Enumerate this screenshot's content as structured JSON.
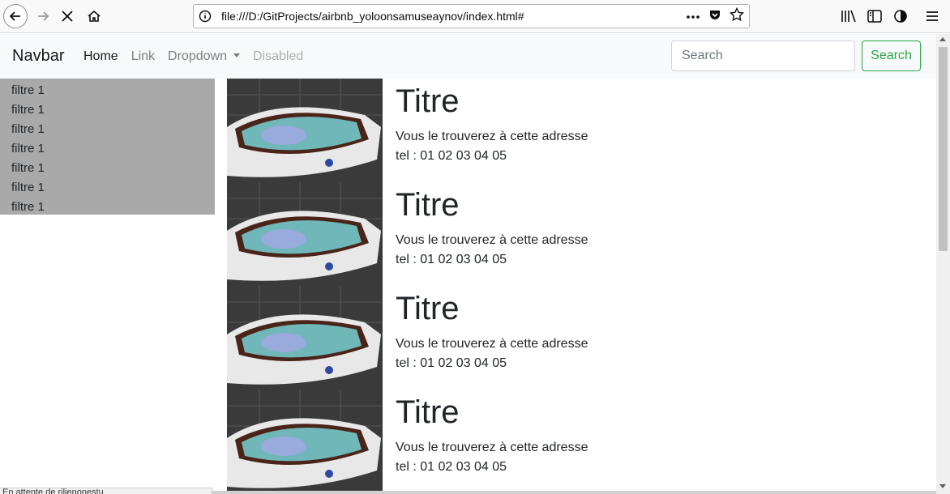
{
  "browser": {
    "url": "file:///D:/GitProjects/airbnb_yoloonsamuseaynov/index.html#",
    "status_text": "En attente de rilienonestu",
    "icons": [
      "back-icon",
      "forward-icon",
      "stop-icon",
      "home-icon",
      "info-icon",
      "more-icon",
      "pocket-icon",
      "star-icon",
      "library-icon",
      "sidebar-icon",
      "shield-icon",
      "menu-icon"
    ]
  },
  "navbar": {
    "brand": "Navbar",
    "links": [
      "Home",
      "Link",
      "Dropdown",
      "Disabled"
    ],
    "search_placeholder": "Search",
    "search_button": "Search"
  },
  "sidebar": {
    "filters": [
      "filtre 1",
      "filtre 1",
      "filtre 1",
      "filtre 1",
      "filtre 1",
      "filtre 1",
      "filtre 1"
    ]
  },
  "cards": [
    {
      "title": "Titre",
      "address": "Vous le trouverez à cette adresse",
      "tel": "tel : 01 02 03 04 05"
    },
    {
      "title": "Titre",
      "address": "Vous le trouverez à cette adresse",
      "tel": "tel : 01 02 03 04 05"
    },
    {
      "title": "Titre",
      "address": "Vous le trouverez à cette adresse",
      "tel": "tel : 01 02 03 04 05"
    },
    {
      "title": "Titre",
      "address": "Vous le trouverez à cette adresse",
      "tel": "tel : 01 02 03 04 05"
    }
  ],
  "colors": {
    "accent_green": "#28a745",
    "sidebar_bg": "#a9a9a9",
    "navbar_bg": "#f8f9fa"
  }
}
